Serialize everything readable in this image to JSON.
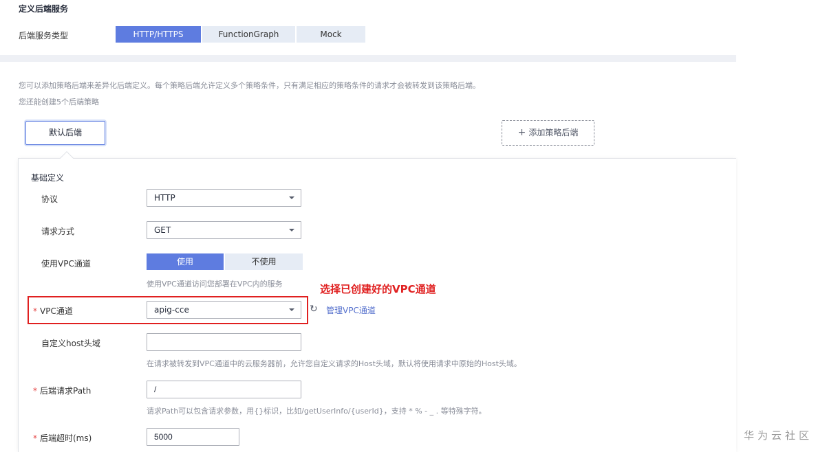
{
  "header": {
    "section_title": "定义后端服务",
    "backend_type_label": "后端服务类型",
    "backend_types": [
      "HTTP/HTTPS",
      "FunctionGraph",
      "Mock"
    ],
    "backend_type_selected": "HTTP/HTTPS"
  },
  "policy": {
    "description": "您可以添加策略后端来差异化后端定义。每个策略后端允许定义多个策略条件，只有满足相应的策略条件的请求才会被转发到该策略后端。",
    "remaining": "您还能创建5个后端策略",
    "default_backend_label": "默认后端",
    "add_policy_label": "添加策略后端"
  },
  "form": {
    "group_title": "基础定义",
    "protocol": {
      "label": "协议",
      "value": "HTTP"
    },
    "method": {
      "label": "请求方式",
      "value": "GET"
    },
    "use_vpc": {
      "label": "使用VPC通道",
      "options": [
        "使用",
        "不使用"
      ],
      "selected": "使用",
      "hint": "使用VPC通道访问您部署在VPC内的服务"
    },
    "vpc_channel": {
      "label": "VPC通道",
      "required": "*",
      "value": "apig-cce",
      "manage_link": "管理VPC通道"
    },
    "custom_host": {
      "label": "自定义host头域",
      "value": "",
      "hint": "在请求被转发到VPC通道中的云服务器前，允许您自定义请求的Host头域，默认将使用请求中原始的Host头域。"
    },
    "backend_path": {
      "label": "后端请求Path",
      "required": "*",
      "value": "/",
      "hint": "请求Path可以包含请求参数，用{}标识，比如/getUserInfo/{userId}，支持 * % - _ . 等特殊字符。"
    },
    "timeout": {
      "label": "后端超时(ms)",
      "required": "*",
      "value": "5000"
    }
  },
  "annotation": "选择已创建好的VPC通道",
  "watermark": "华为云社区",
  "colors": {
    "accent": "#5e7ce0",
    "annotation": "#e02020",
    "link": "#526ecc"
  }
}
